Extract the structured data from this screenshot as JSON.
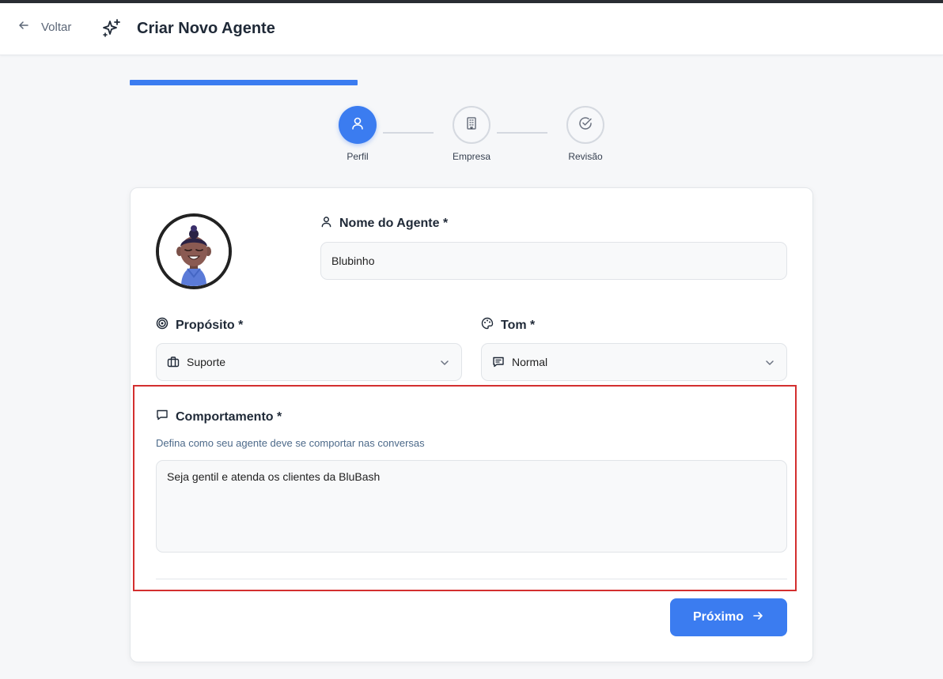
{
  "header": {
    "back_label": "Voltar",
    "title": "Criar Novo Agente"
  },
  "wizard": {
    "progress_fraction": 0.33,
    "steps": [
      {
        "label": "Perfil",
        "icon": "user-icon",
        "state": "active"
      },
      {
        "label": "Empresa",
        "icon": "building-icon",
        "state": "inactive"
      },
      {
        "label": "Revisão",
        "icon": "check-circle-icon",
        "state": "inactive"
      }
    ]
  },
  "form": {
    "name": {
      "label": "Nome do Agente *",
      "value": "Blubinho"
    },
    "purpose": {
      "label": "Propósito *",
      "value": "Suporte"
    },
    "tone": {
      "label": "Tom *",
      "value": "Normal"
    },
    "behavior": {
      "label": "Comportamento *",
      "hint": "Defina como seu agente deve se comportar nas conversas",
      "value": "Seja gentil e atenda os clientes da BluBash"
    },
    "next_label": "Próximo"
  },
  "colors": {
    "accent": "#3b7cf0",
    "highlight": "#d32f2f"
  }
}
